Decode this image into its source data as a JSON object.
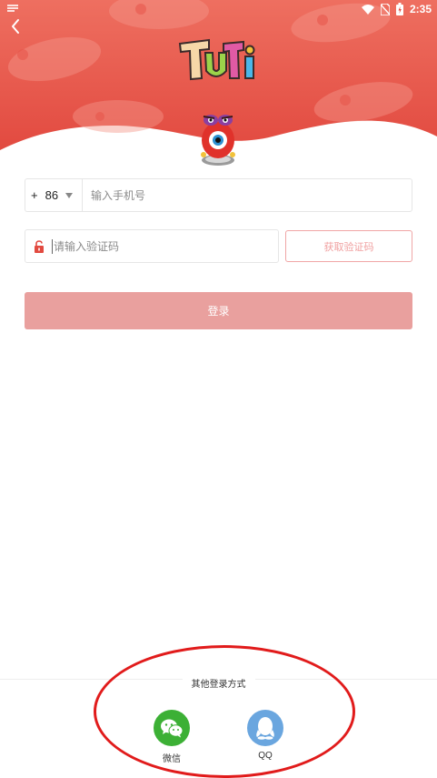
{
  "status_bar": {
    "time": "2:35",
    "icons": [
      "wifi-icon",
      "no-sim-icon",
      "battery-icon"
    ]
  },
  "header": {
    "back_icon": "chevron-left-icon",
    "logo_text": "TUTI",
    "colors": {
      "header_red": "#e8534a",
      "header_red_light": "#ef7265"
    }
  },
  "form": {
    "country_code_plus": "+",
    "country_code": "86",
    "phone_placeholder": "输入手机号",
    "code_placeholder": "请输入验证码",
    "get_code_label": "获取验证码",
    "login_label": "登录"
  },
  "other_login": {
    "title": "其他登录方式",
    "options": [
      {
        "label": "微信",
        "icon": "wechat-icon",
        "color": "#3cb035"
      },
      {
        "label": "QQ",
        "icon": "qq-icon",
        "color": "#6aa6df"
      }
    ]
  }
}
